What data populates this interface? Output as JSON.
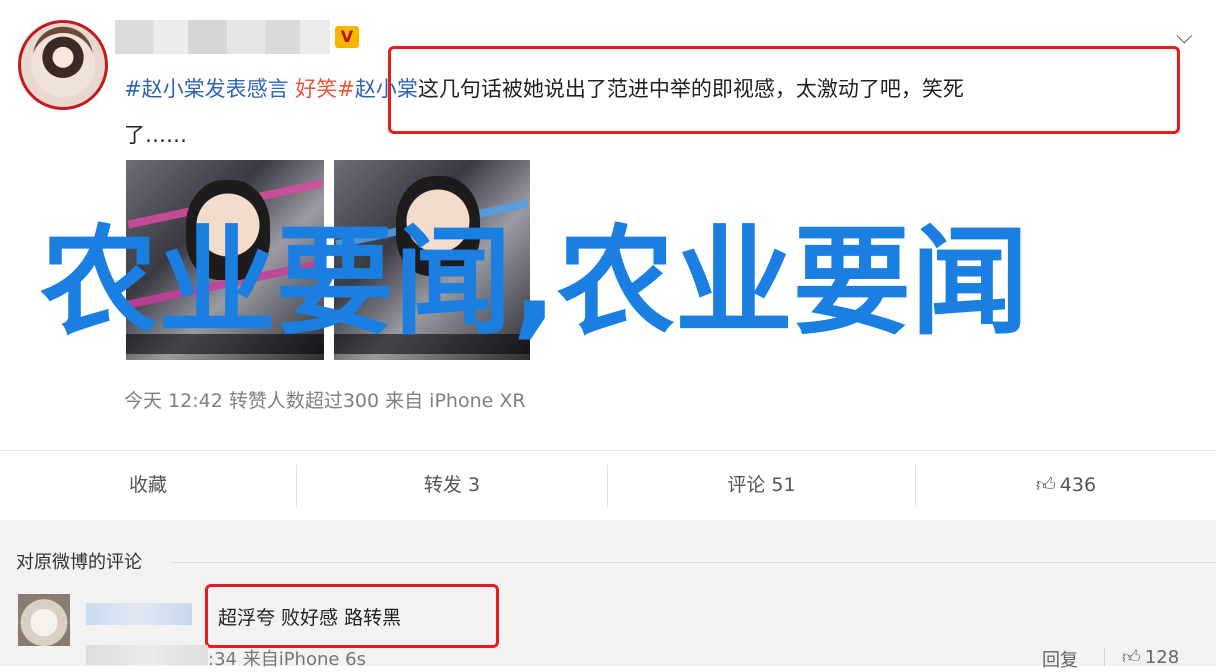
{
  "post": {
    "vip_badge": "V",
    "tag_1": "#赵小棠发表感言",
    "tag_2": "好笑#",
    "mention": "赵小棠",
    "text_line": "这几句话被她说出了范进中举的即视感，太激动了吧，笑死",
    "text_cont": "了……",
    "meta": "今天 12:42 转赞人数超过300  来自 iPhone XR"
  },
  "watermark": {
    "title": "农业要闻,农业要闻",
    "comma": ","
  },
  "actions": {
    "collect": "收藏",
    "repost": "转发 3",
    "comment": "评论 51",
    "like": "436"
  },
  "comments": {
    "section_title": "对原微博的评论",
    "items": [
      {
        "text": "超浮夸 败好感 路转黑",
        "meta": ":34 来自iPhone 6s",
        "reply_label": "回复",
        "likes": "128"
      }
    ]
  },
  "icons": {
    "chevron": "chevron-down-icon",
    "thumb": "thumb-up-icon"
  },
  "colors": {
    "highlight_red": "#e21d1d",
    "watermark_blue": "#1a7fe0",
    "link_blue": "#2f63b4"
  }
}
